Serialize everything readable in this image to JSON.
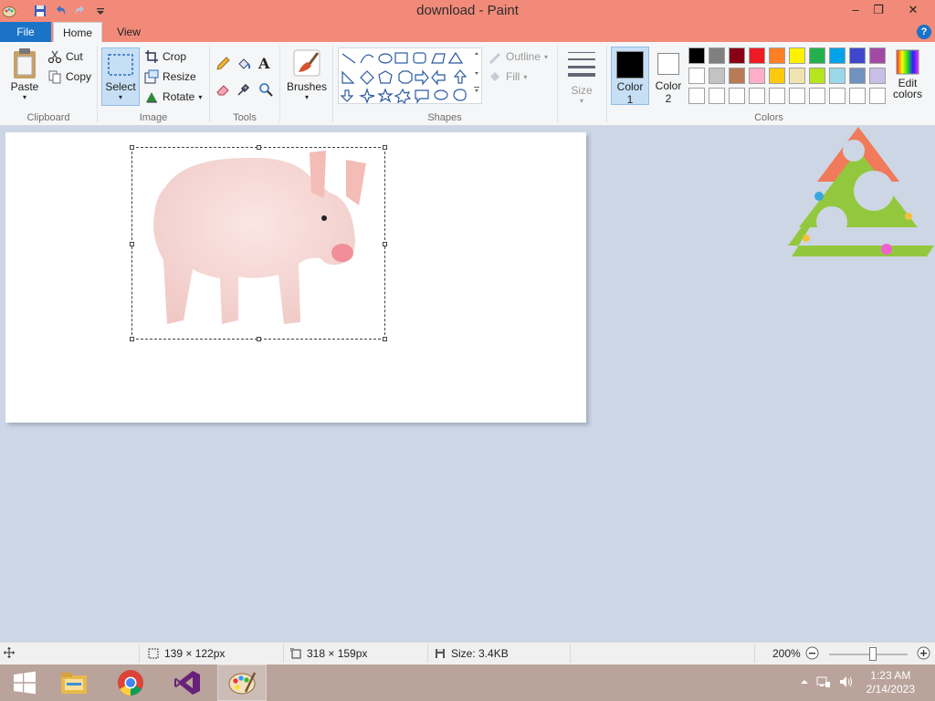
{
  "window": {
    "title": "download - Paint",
    "minimize": "–",
    "maximize": "❐",
    "close": "✕"
  },
  "tabs": {
    "file": "File",
    "home": "Home",
    "view": "View",
    "help": "?"
  },
  "clipboard": {
    "paste": "Paste",
    "cut": "Cut",
    "copy": "Copy",
    "label": "Clipboard"
  },
  "image": {
    "select": "Select",
    "crop": "Crop",
    "resize": "Resize",
    "rotate": "Rotate",
    "label": "Image"
  },
  "tools": {
    "label": "Tools",
    "text_tool": "A"
  },
  "brushes": {
    "label": "Brushes"
  },
  "shapes": {
    "outline": "Outline",
    "fill": "Fill",
    "label": "Shapes"
  },
  "size": {
    "label": "Size"
  },
  "colors": {
    "color1": "Color",
    "color1_num": "1",
    "color2": "Color",
    "color2_num": "2",
    "label": "Colors",
    "edit": "Edit",
    "edit2": "colors",
    "palette": [
      "#000000",
      "#7f7f7f",
      "#880015",
      "#ed1c24",
      "#ff7f27",
      "#fff200",
      "#22b14c",
      "#00a2e8",
      "#3f48cc",
      "#a349a4",
      "#ffffff",
      "#c3c3c3",
      "#b97a57",
      "#ffaec9",
      "#ffc90e",
      "#efe4b0",
      "#b5e61d",
      "#99d9ea",
      "#7092be",
      "#c8bfe7",
      "#ffffff",
      "#ffffff",
      "#ffffff",
      "#ffffff",
      "#ffffff",
      "#ffffff",
      "#ffffff",
      "#ffffff",
      "#ffffff",
      "#ffffff"
    ]
  },
  "status": {
    "selection_size": "139 × 122px",
    "image_size": "318 × 159px",
    "file_size": "Size: 3.4KB",
    "zoom": "200%"
  },
  "taskbar": {
    "time": "1:23 AM",
    "date": "2/14/2023",
    "apps": [
      "windows-start",
      "file-explorer",
      "chrome",
      "visual-studio",
      "paint"
    ]
  }
}
